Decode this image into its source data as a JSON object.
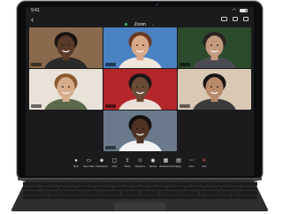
{
  "statusbar": {
    "time": "9:41"
  },
  "meeting": {
    "title": "Zoom",
    "chevron": "⌄"
  },
  "participants": [
    {
      "id": "p1",
      "name": "",
      "skin": "#5a3a28",
      "bg": "#8a6a4c",
      "shirt": "#2a2a2a",
      "hair": "#1a1410"
    },
    {
      "id": "p2",
      "name": "",
      "skin": "#d8a888",
      "bg": "#4a82c4",
      "shirt": "#f0e6dc",
      "hair": "#6a3a22"
    },
    {
      "id": "p3",
      "name": "",
      "skin": "#c49a7e",
      "bg": "#2c4a2c",
      "shirt": "#4a4a50",
      "hair": "#2a2420"
    },
    {
      "id": "p4",
      "name": "",
      "skin": "#d6ac8c",
      "bg": "#e8e2d8",
      "shirt": "#5a6a4a",
      "hair": "#8a5a2e"
    },
    {
      "id": "p5",
      "name": "",
      "skin": "#6a4a34",
      "bg": "#b4262a",
      "shirt": "#e8e0d8",
      "hair": "#1a1614"
    },
    {
      "id": "p6",
      "name": "",
      "skin": "#b88a6a",
      "bg": "#d8c8b4",
      "shirt": "#3a3a3a",
      "hair": "#1c1612"
    },
    {
      "id": "p7",
      "name": "",
      "skin": "#4e3224",
      "bg": "#6a7a8c",
      "shirt": "#f2f2f2",
      "hair": "#141010"
    }
  ],
  "toolbar": {
    "items": [
      {
        "key": "mute",
        "glyph": "●",
        "label": "Mute"
      },
      {
        "key": "video",
        "glyph": "▭",
        "label": "Stop Video"
      },
      {
        "key": "participants",
        "glyph": "☻",
        "label": "Participants"
      },
      {
        "key": "chat",
        "glyph": "▢",
        "label": "Chat"
      },
      {
        "key": "share",
        "glyph": "⇪",
        "label": "Share"
      },
      {
        "key": "reactions",
        "glyph": "☺",
        "label": "Reactions"
      },
      {
        "key": "record",
        "glyph": "◉",
        "label": "Record"
      },
      {
        "key": "breakout",
        "glyph": "▦",
        "label": "Breakout Rooms"
      },
      {
        "key": "apps",
        "glyph": "▤",
        "label": "Apps"
      },
      {
        "key": "more",
        "glyph": "⋯",
        "label": "More"
      },
      {
        "key": "end",
        "glyph": "✕",
        "label": "End"
      }
    ]
  },
  "colors": {
    "accent_green": "#31c15a",
    "end_red": "#ff4d3d"
  }
}
